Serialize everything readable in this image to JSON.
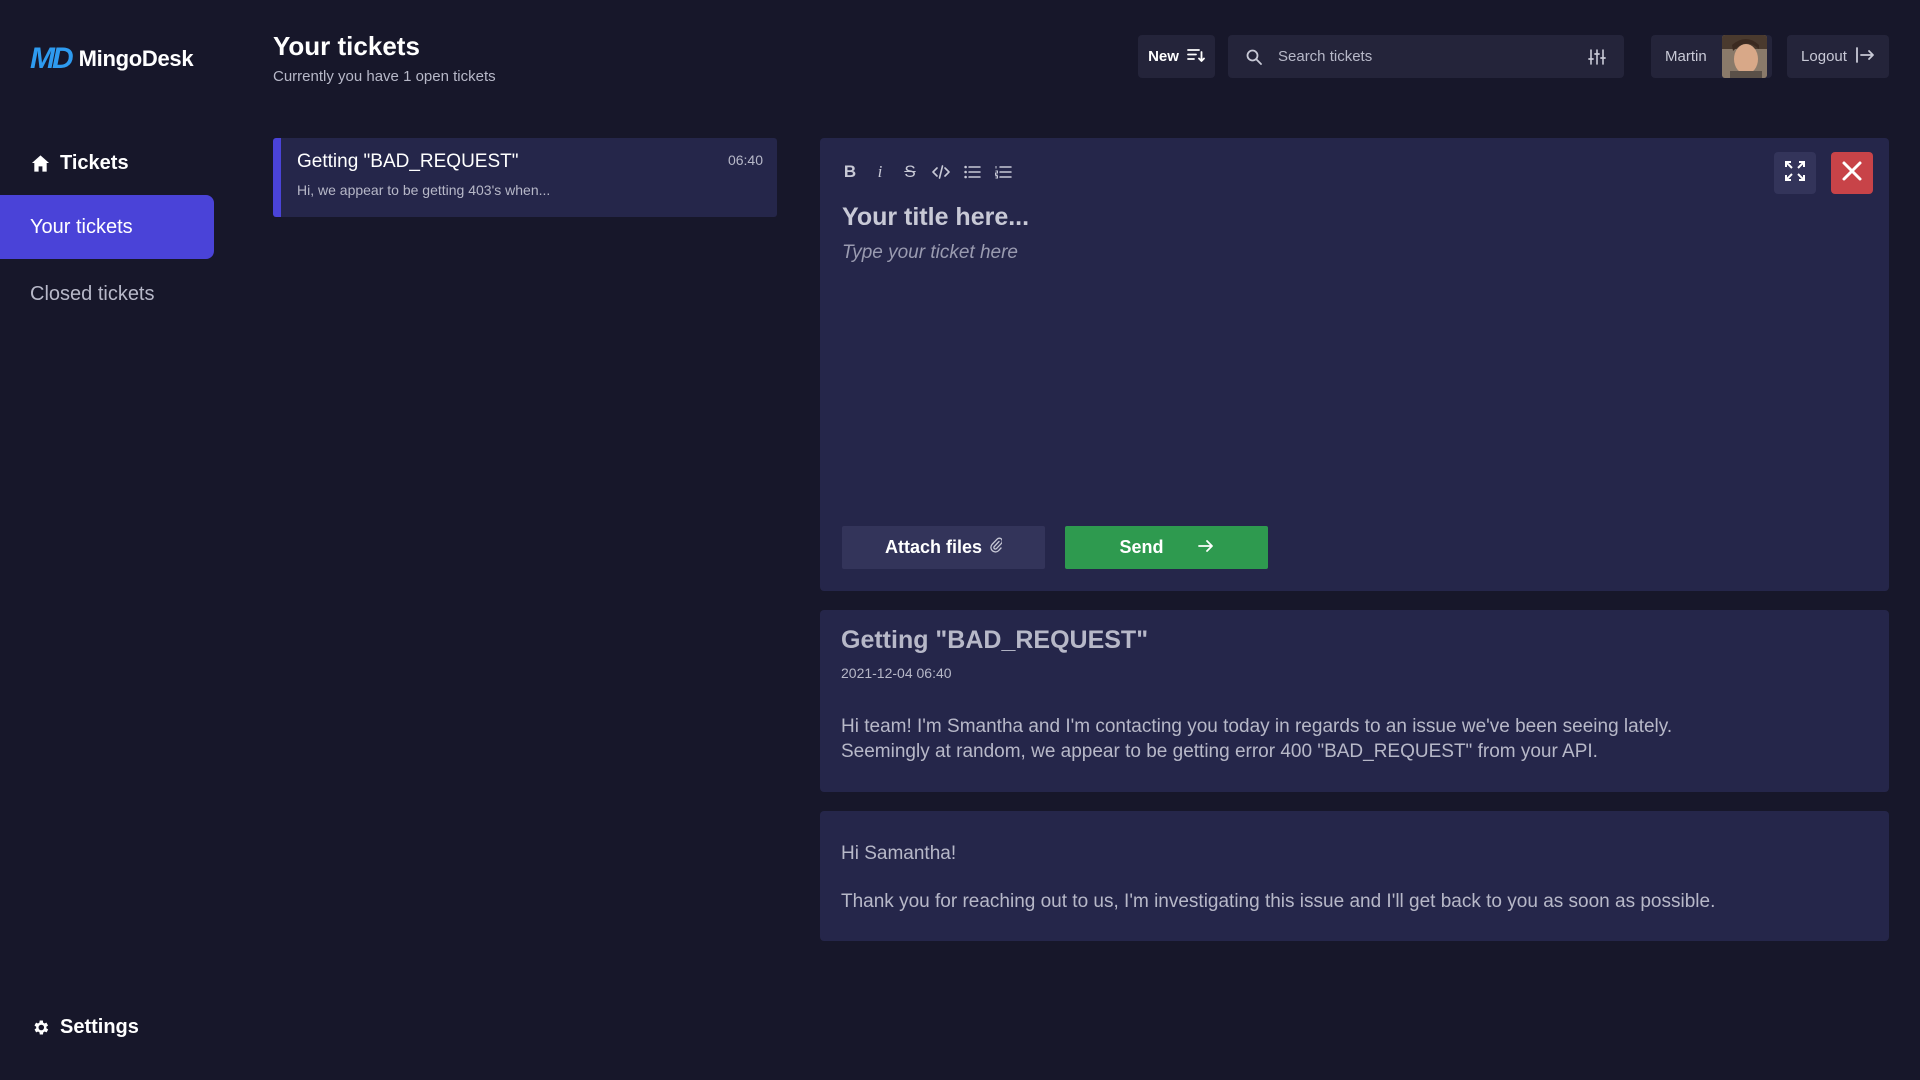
{
  "app": {
    "logo_mark": "MD",
    "name": "MingoDesk"
  },
  "sidebar": {
    "items": [
      {
        "label": "Tickets",
        "icon": "home-icon"
      },
      {
        "label": "Your tickets"
      },
      {
        "label": "Closed tickets"
      }
    ],
    "settings": {
      "label": "Settings",
      "icon": "gear-icon"
    }
  },
  "header": {
    "title": "Your tickets",
    "subtitle": "Currently you have 1 open tickets",
    "new_label": "New",
    "search_placeholder": "Search tickets",
    "user_name": "Martin",
    "logout_label": "Logout"
  },
  "ticket_list": [
    {
      "title": "Getting \"BAD_REQUEST\"",
      "time": "06:40",
      "preview": "Hi, we appear to be getting 403's when..."
    }
  ],
  "editor": {
    "toolbar": {
      "bold": "B",
      "italic": "i",
      "strike": "S"
    },
    "title_placeholder": "Your title here...",
    "body_placeholder": "Type your ticket here",
    "attach_label": "Attach files",
    "send_label": "Send"
  },
  "messages": [
    {
      "title": "Getting \"BAD_REQUEST\"",
      "date": "2021-12-04 06:40",
      "body_line1": "Hi team! I'm Smantha and I'm contacting you today in regards to an issue we've been seeing lately.",
      "body_line2": "Seemingly at random, we appear to be getting error 400 \"BAD_REQUEST\" from your API."
    },
    {
      "greeting": "Hi Samantha!",
      "text": "Thank you for reaching out to us, I'm investigating this issue and I'll get back to you as soon as possible."
    }
  ],
  "colors": {
    "background": "#17172a",
    "panel": "#25264a",
    "accent": "#4a43d8",
    "send": "#2e9a4f",
    "close": "#c84348",
    "logo": "#2e9bf0"
  }
}
